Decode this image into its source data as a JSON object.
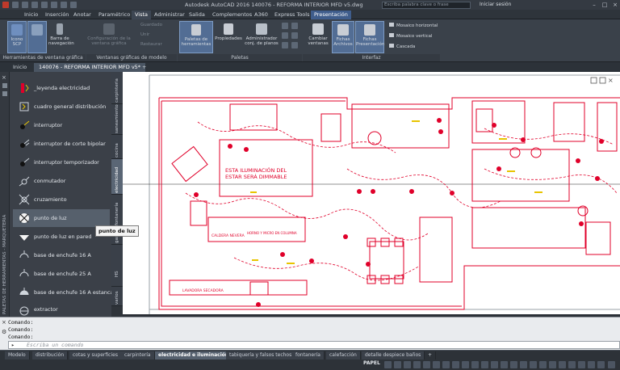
{
  "window": {
    "title": "Autodesk AutoCAD 2016   140076 - REFORMA INTERIOR MFD v5.dwg",
    "search_placeholder": "Escriba palabra clave o frase",
    "login_label": "Iniciar sesión"
  },
  "menu_tabs": [
    "Inicio",
    "Inserción",
    "Anotar",
    "Paramétrico",
    "Vista",
    "Administrar",
    "Salida",
    "Complementos",
    "A360",
    "Express Tools",
    "Presentación"
  ],
  "ribbon": {
    "icono_scp": "Icono SCP",
    "cubo_vistas": "Cubo de vistas",
    "barra_navegacion": "Barra de navegación",
    "config_ventanas": "Configuración de la ventana gráfica",
    "guardado": "Guardado",
    "unir": "Unir",
    "restaurar": "Restaurar",
    "paletas_herramientas": "Paletas de herramientas",
    "propiedades": "Propiedades",
    "administrador_planos": "Administrador conj. de planos",
    "cambiar_ventanas": "Cambiar ventanas",
    "fichas_archivos": "Fichas Archivos",
    "fichas_presentacion": "Fichas Presentación",
    "mosaico_horizontal": "Mosaico horizontal",
    "mosaico_vertical": "Mosaico vertical",
    "cascada": "Cascada",
    "panel_herramientas_ventana": "Herramientas de ventana gráfica",
    "panel_ventanas_modelo": "Ventanas gráficas de modelo",
    "panel_paletas": "Paletas",
    "panel_interfaz": "Interfaz"
  },
  "doc_tabs": [
    "Inicio",
    "140076 - REFORMA INTERIOR MFD v5*"
  ],
  "palette": {
    "side_title": "PALETAS DE HERRAMIENTAS - MARQUETERIA",
    "items": [
      "_leyenda electricidad",
      "cuadro general distribución",
      "interruptor",
      "interruptor de corte bipolar",
      "interruptor temporizador",
      "conmutador",
      "cruzamiento",
      "punto de luz",
      "punto de luz en pared",
      "base de enchufe 16 A",
      "base de enchufe 25 A",
      "base de enchufe 16 A estanca",
      "extractor"
    ],
    "vertical_tabs": [
      "carpinteria",
      "saneamiento",
      "cocina",
      "electricidad",
      "fontanería",
      "gas",
      "HS",
      "varios"
    ],
    "tooltip": "punto de luz"
  },
  "drawing_labels": {
    "note_line1": "ESTA ILUMINACIÓN DEL",
    "note_line2": "ESTAR SERÁ DIMMABLE",
    "caldera": "CALDERA  NEVERA",
    "horno": "HORNO Y MICRO EN COLUMNA",
    "lavadora": "LAVADORA  SECADORA"
  },
  "command": {
    "lines": [
      "Comando:",
      "Comando:",
      "Comando:"
    ],
    "placeholder": "Escriba un comando"
  },
  "layout_tabs": [
    "Modelo",
    "distribución",
    "cotas y superficies",
    "carpintería",
    "electricidad e iluminación",
    "tabiquería y falsos techos",
    "fontanería",
    "calefacción",
    "detalle despiece baños"
  ],
  "status": {
    "space": "PAPEL"
  },
  "colors": {
    "accent": "#3f5d8c",
    "plan_red": "#e0002a",
    "ribbon_bg": "#3a414a"
  }
}
